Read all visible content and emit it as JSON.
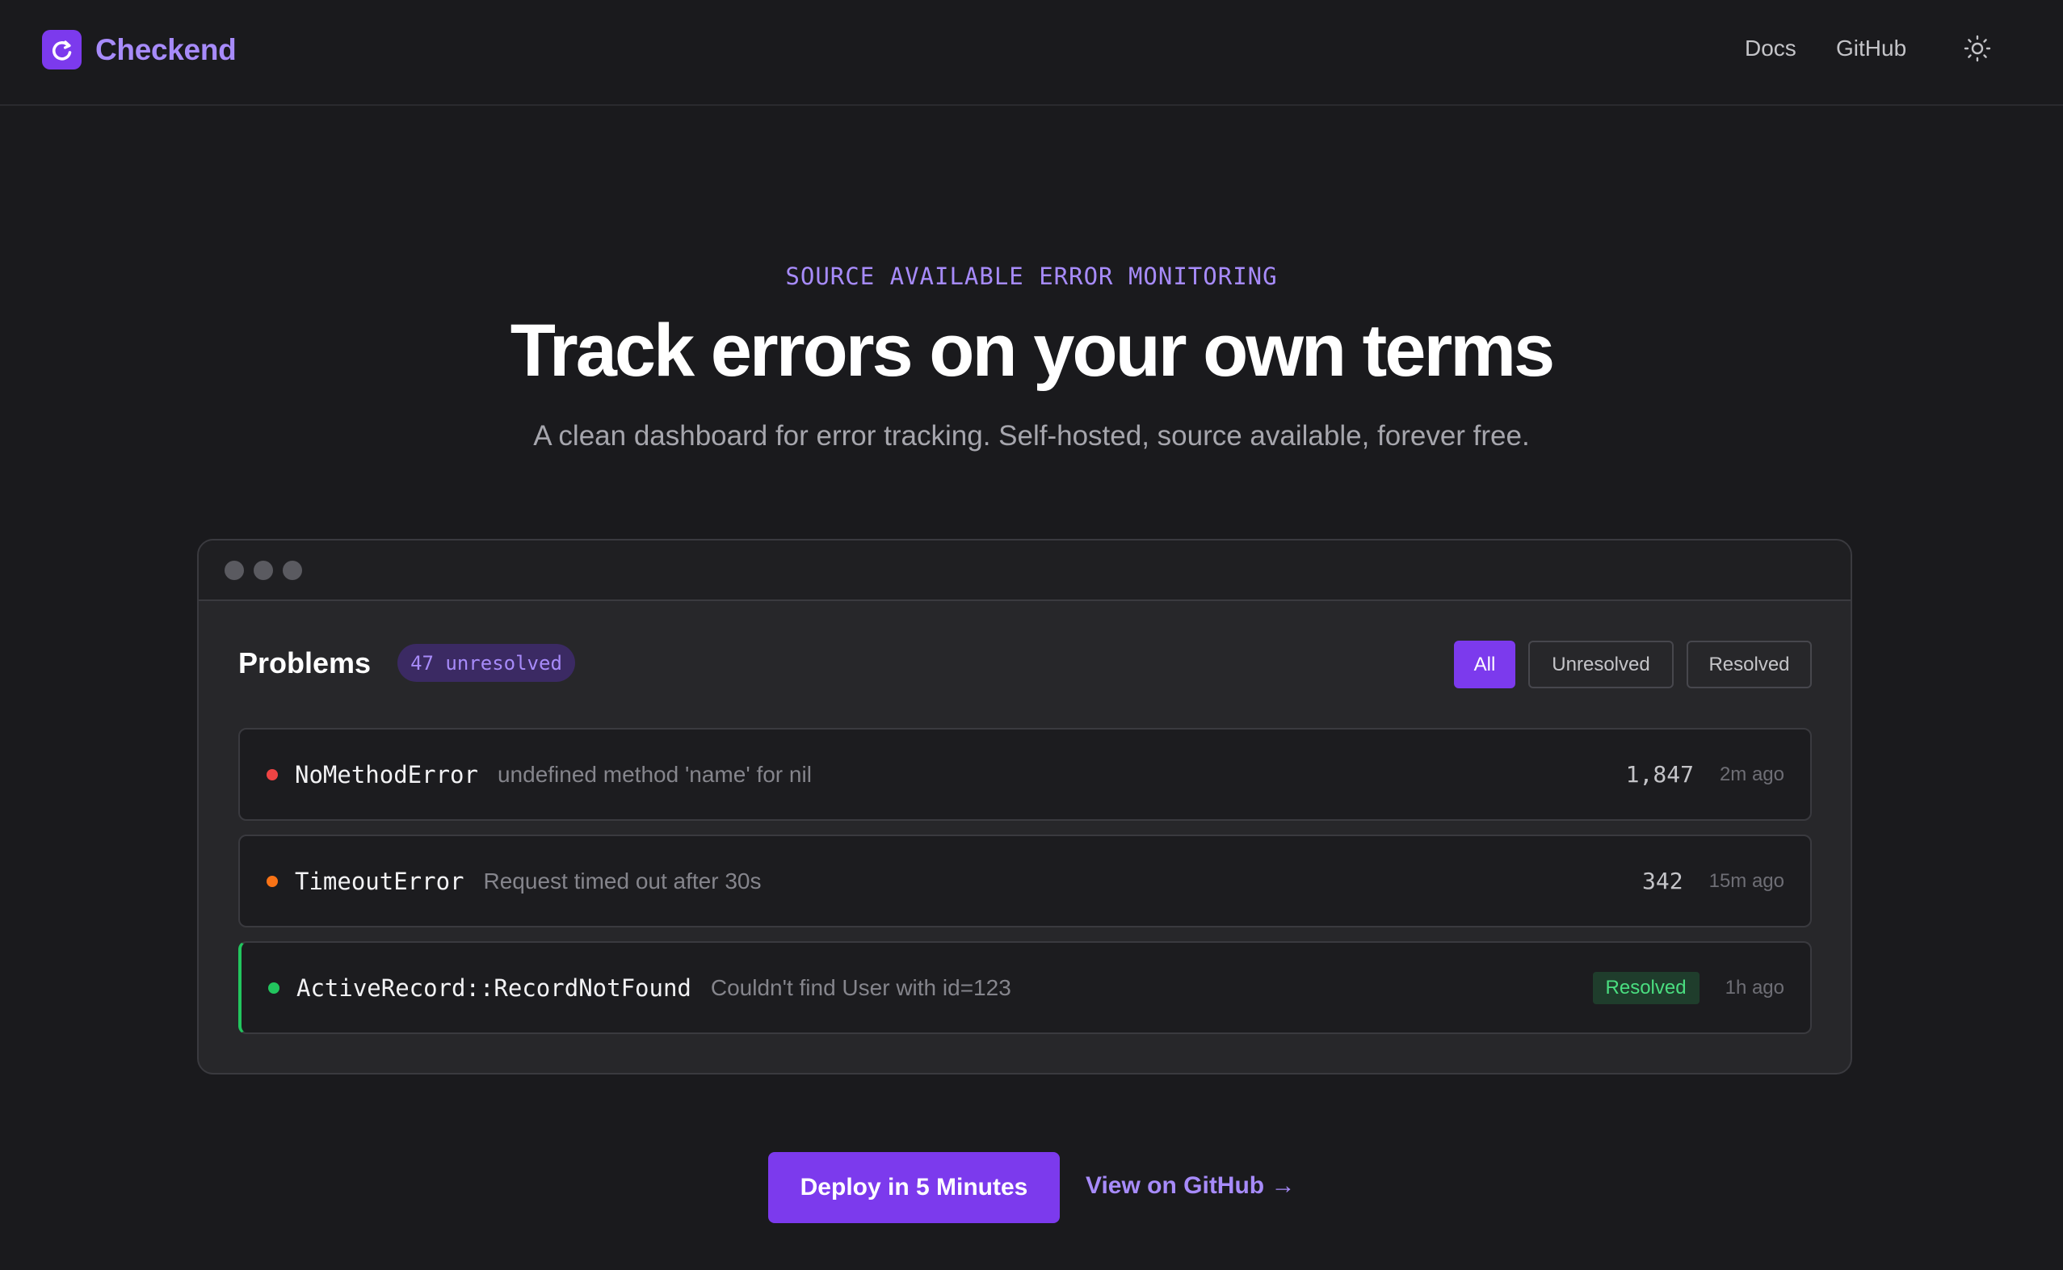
{
  "header": {
    "brand_name": "Checkend",
    "nav": {
      "docs": "Docs",
      "github": "GitHub"
    },
    "theme_icon": "sun-icon"
  },
  "hero": {
    "eyebrow": "SOURCE AVAILABLE ERROR MONITORING",
    "title": "Track errors on your own terms",
    "subtitle": "A clean dashboard for error tracking. Self-hosted, source available, forever free."
  },
  "preview": {
    "title": "Problems",
    "count_badge": "47 unresolved",
    "filters": {
      "all": "All",
      "unresolved": "Unresolved",
      "resolved": "Resolved"
    },
    "active_filter": "All",
    "rows": [
      {
        "name": "NoMethodError",
        "message": "undefined method 'name' for nil",
        "count": "1,847",
        "time": "2m ago",
        "status_color": "#ef4444"
      },
      {
        "name": "TimeoutError",
        "message": "Request timed out after 30s",
        "count": "342",
        "time": "15m ago",
        "status_color": "#f97316"
      },
      {
        "name": "ActiveRecord::RecordNotFound",
        "message": "Couldn't find User with id=123",
        "badge": "Resolved",
        "time": "1h ago",
        "status_color": "#22c55e"
      }
    ]
  },
  "cta": {
    "primary": "Deploy in 5 Minutes",
    "secondary": "View on GitHub →"
  },
  "colors": {
    "accent": "#7c3aed",
    "accent_text": "#a78bfa",
    "background": "#1a1a1d",
    "resolved": "#22c55e"
  }
}
